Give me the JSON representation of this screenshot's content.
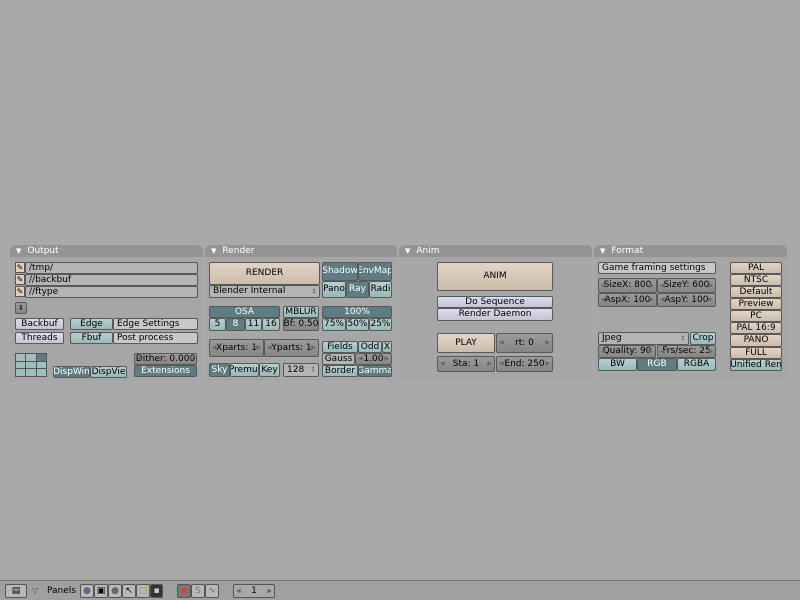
{
  "output": {
    "title": "Output",
    "paths": [
      "/tmp/",
      "//backbuf",
      "//ftype"
    ],
    "backbuf": "Backbuf",
    "edge": "Edge",
    "edge_settings": "Edge Settings",
    "threads": "Threads",
    "fbuf": "Fbuf",
    "post_process": "Post process",
    "dispwin": "DispWin",
    "dispview": "DispVie",
    "dither": "Dither: 0.000",
    "extensions": "Extensions"
  },
  "render": {
    "title": "Render",
    "render_btn": "RENDER",
    "renderer": "Blender Internal",
    "shadow": "Shadow",
    "envmap": "EnvMap",
    "pano": "Pano",
    "ray": "Ray",
    "radi": "Radi",
    "osa": "OSA",
    "osa_levels": [
      "5",
      "8",
      "11",
      "16"
    ],
    "osa_selected": "8",
    "mblur": "MBLUR",
    "bf": "Bf: 0.50",
    "percent": "100%",
    "percents": [
      "75%",
      "50%",
      "25%"
    ],
    "xparts": "Xparts: 1",
    "yparts": "Yparts: 1",
    "fields": "Fields",
    "odd": "Odd",
    "x": "X",
    "filter": "Gauss",
    "filter_size": "1.00",
    "border": "Border",
    "gamma": "Gamma",
    "sky": "Sky",
    "premul": "Premul",
    "key": "Key",
    "bits": "128"
  },
  "anim": {
    "title": "Anim",
    "anim_btn": "ANIM",
    "do_sequence": "Do Sequence",
    "render_daemon": "Render Daemon",
    "play": "PLAY",
    "rt": "rt: 0",
    "sta": "Sta: 1",
    "end": "End: 250"
  },
  "format": {
    "title": "Format",
    "game_framing": "Game framing settings",
    "sizex": "SizeX: 800",
    "sizey": "SizeY: 600",
    "aspx": "AspX: 100",
    "aspy": "AspY: 100",
    "file_type": "Jpeg",
    "crop": "Crop",
    "quality": "Quality: 90",
    "fps": "Frs/sec: 25",
    "bw": "BW",
    "rgb": "RGB",
    "rgba": "RGBA",
    "color_selected": "RGB",
    "presets": [
      "PAL",
      "NTSC",
      "Default",
      "Preview",
      "PC",
      "PAL 16:9",
      "PANO",
      "FULL"
    ],
    "unified": "Unified Ren"
  },
  "header": {
    "panels_label": "Panels",
    "frame": "1"
  }
}
